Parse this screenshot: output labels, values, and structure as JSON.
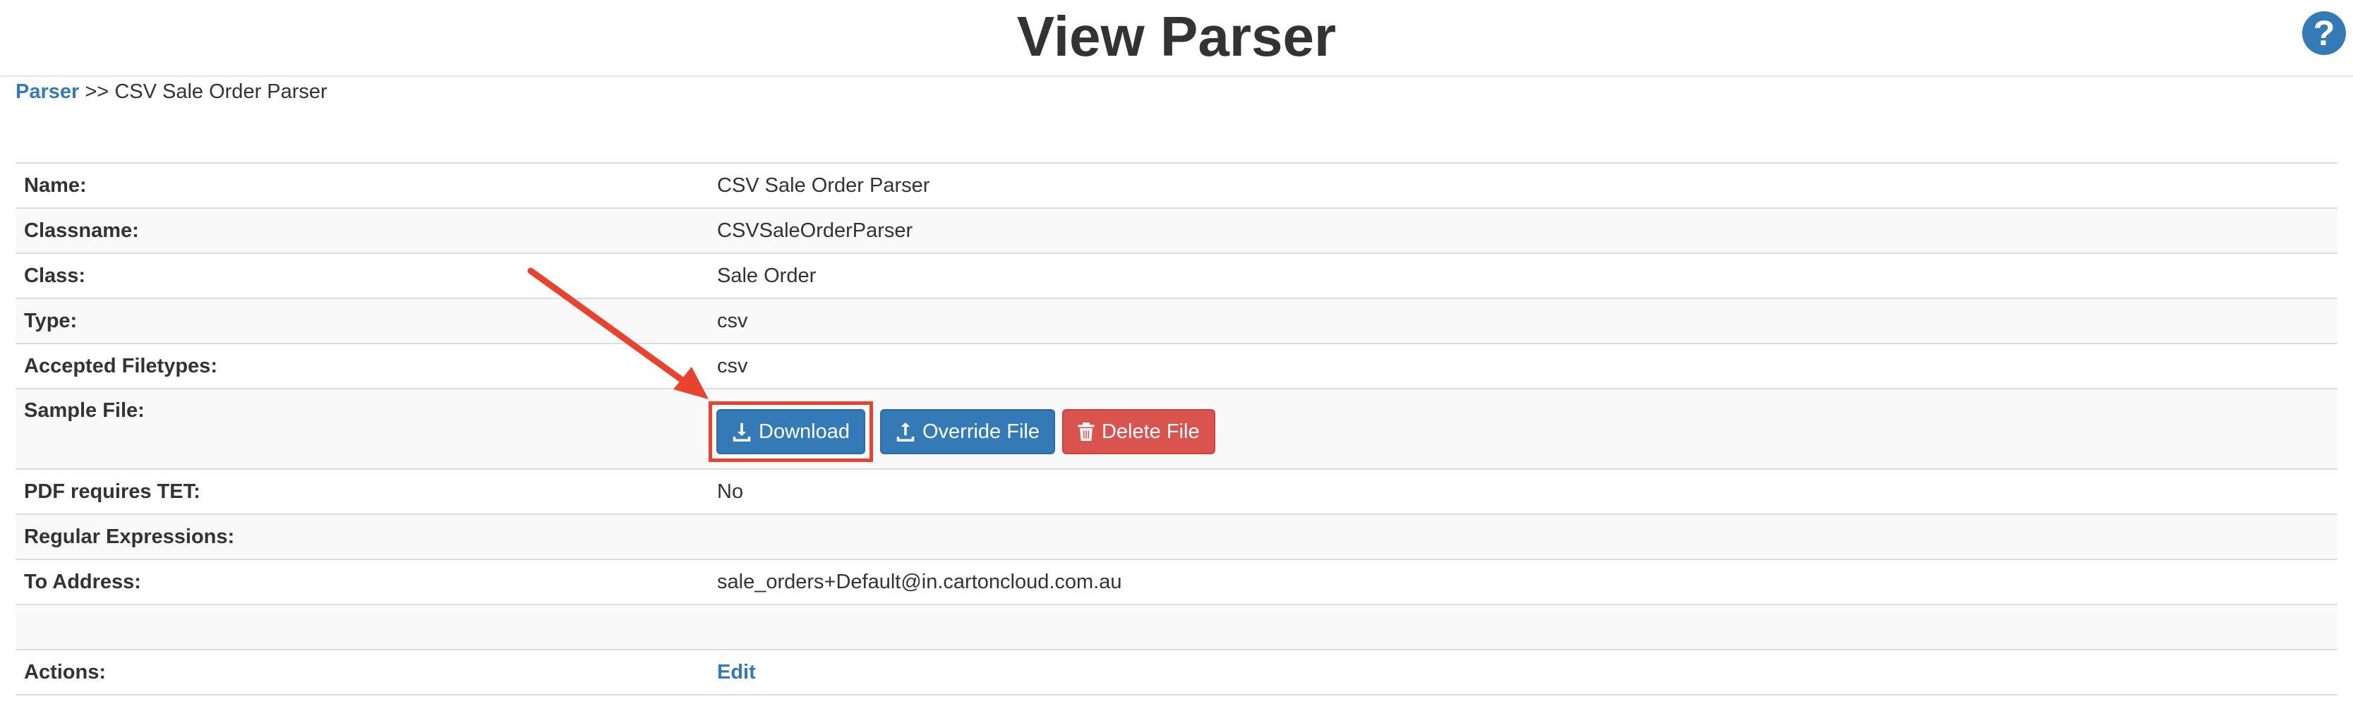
{
  "header": {
    "title": "View Parser",
    "help_icon": "?"
  },
  "breadcrumb": {
    "link_label": "Parser",
    "separator": ">>",
    "current": "CSV Sale Order Parser"
  },
  "details": {
    "name_label": "Name:",
    "name_value": "CSV Sale Order Parser",
    "classname_label": "Classname:",
    "classname_value": "CSVSaleOrderParser",
    "class_label": "Class:",
    "class_value": "Sale Order",
    "type_label": "Type:",
    "type_value": "csv",
    "filetypes_label": "Accepted Filetypes:",
    "filetypes_value": "csv",
    "sample_label": "Sample File:",
    "pdf_label": "PDF requires TET:",
    "pdf_value": "No",
    "regex_label": "Regular Expressions:",
    "regex_value": "",
    "address_label": "To Address:",
    "address_value": "sale_orders+Default@in.cartoncloud.com.au",
    "actions_label": "Actions:",
    "edit_label": "Edit"
  },
  "buttons": {
    "download_label": "Download",
    "override_label": "Override File",
    "delete_label": "Delete File"
  },
  "colors": {
    "primary": "#337ab7",
    "danger": "#d9534f",
    "annotation": "#e8432f"
  },
  "icons": {
    "help": "question-circle-icon",
    "download": "download-icon",
    "upload": "upload-icon",
    "delete": "trash-icon"
  }
}
